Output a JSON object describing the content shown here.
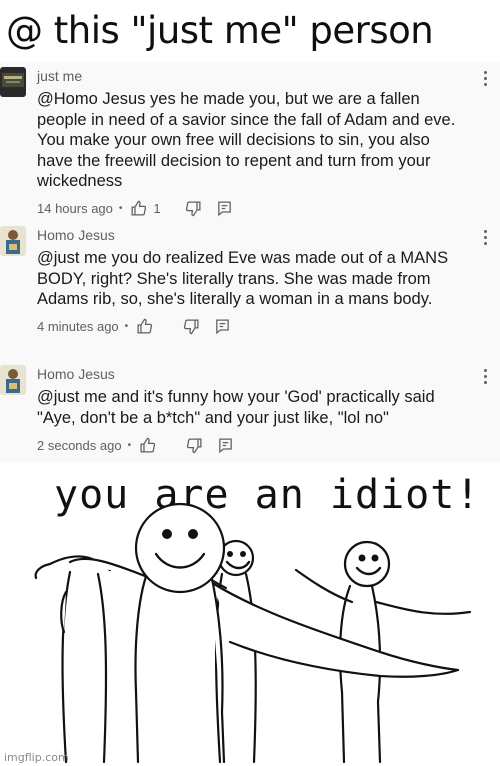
{
  "caption": "@  this \"just me\" person",
  "comments": [
    {
      "author": "just me",
      "text": " @Homo Jesus  yes he made you, but we are a fallen people in need of a savior since the fall of Adam and eve. You make your own free will decisions to sin, you also have the freewill decision to repent and turn from your wickedness",
      "time": "14 hours ago",
      "likes": "1"
    },
    {
      "author": "Homo Jesus",
      "text": "@just me  you do realized Eve was made out of a MANS BODY, right? She's literally trans. She was made from Adams rib, so, she's literally a woman in a mans body.",
      "time": "4 minutes ago",
      "likes": ""
    },
    {
      "author": "Homo Jesus",
      "text": "@just me  and it's funny how your 'God' practically said \"Aye, don't be a b*tch\" and your just like, \"lol no\"",
      "time": "2 seconds ago",
      "likes": ""
    }
  ],
  "meme": {
    "title": "you are an idiot!"
  },
  "watermark": "imgflip.com",
  "icons": {
    "like": "thumbs-up-icon",
    "dislike": "thumbs-down-icon",
    "reply": "reply-icon",
    "menu": "more-vertical-icon"
  }
}
